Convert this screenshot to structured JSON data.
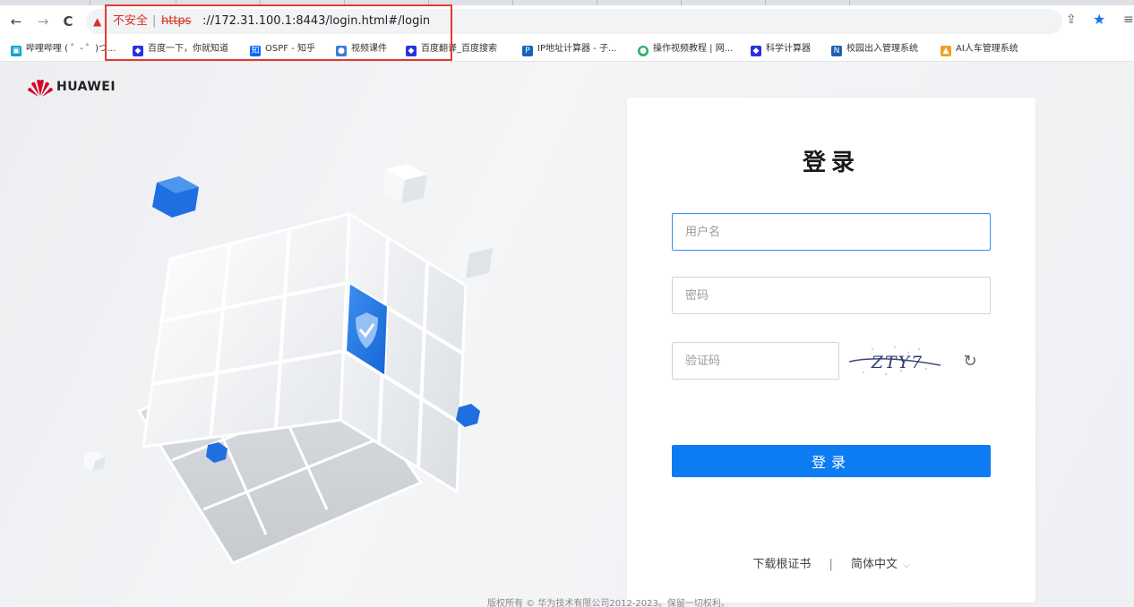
{
  "browser": {
    "address_bar": {
      "security_label": "不安全",
      "separator": "|",
      "scheme": "https",
      "url_rest": "://172.31.100.1:8443/login.html#/login"
    },
    "nav": {
      "back": "←",
      "forward": "→",
      "reload": "C"
    },
    "icons": {
      "share": "⇪",
      "star": "★",
      "menu": "≡",
      "warning": "▲"
    },
    "bookmarks": [
      {
        "label": "哔哩哔哩 ( ゜- ゜)つ...",
        "icon": "bilibili-icon",
        "color": "#00a1d6"
      },
      {
        "label": "百度一下，你就知道",
        "icon": "baidu-icon",
        "color": "#2932e1"
      },
      {
        "label": "OSPF - 知乎",
        "icon": "zhihu-icon",
        "color": "#0066ff"
      },
      {
        "label": "视频课件",
        "icon": "cloud-icon",
        "color": "#3c7be0"
      },
      {
        "label": "百度翻译_百度搜索",
        "icon": "baidu-icon",
        "color": "#2932e1"
      },
      {
        "label": "IP地址计算器 - 子...",
        "icon": "ip-icon",
        "color": "#1565c0"
      },
      {
        "label": "操作视频教程 | 网...",
        "icon": "wechat-icon",
        "color": "#2aae67"
      },
      {
        "label": "科学计算器",
        "icon": "baidu-icon",
        "color": "#2932e1"
      },
      {
        "label": "校园出入管理系统",
        "icon": "campus-icon",
        "color": "#1e5fb4"
      },
      {
        "label": "AI人车管理系统",
        "icon": "ai-icon",
        "color": "#f0a028"
      }
    ]
  },
  "page": {
    "brand": "HUAWEI",
    "login": {
      "title": "登录",
      "username_placeholder": "用户名",
      "password_placeholder": "密码",
      "captcha_placeholder": "验证码",
      "captcha_text": "ZTY7",
      "refresh_icon": "↻",
      "submit_label": "登录",
      "download_cert": "下载根证书",
      "separator": "|",
      "language": "简体中文",
      "chevron": "⌵"
    },
    "copyright": "版权所有 © 华为技术有限公司2012-2023。保留一切权利。"
  },
  "colors": {
    "primary": "#0d7cf2",
    "insecure_red": "#d93025",
    "annotation_box": "#e53935",
    "huawei_red": "#cf0a2c"
  }
}
